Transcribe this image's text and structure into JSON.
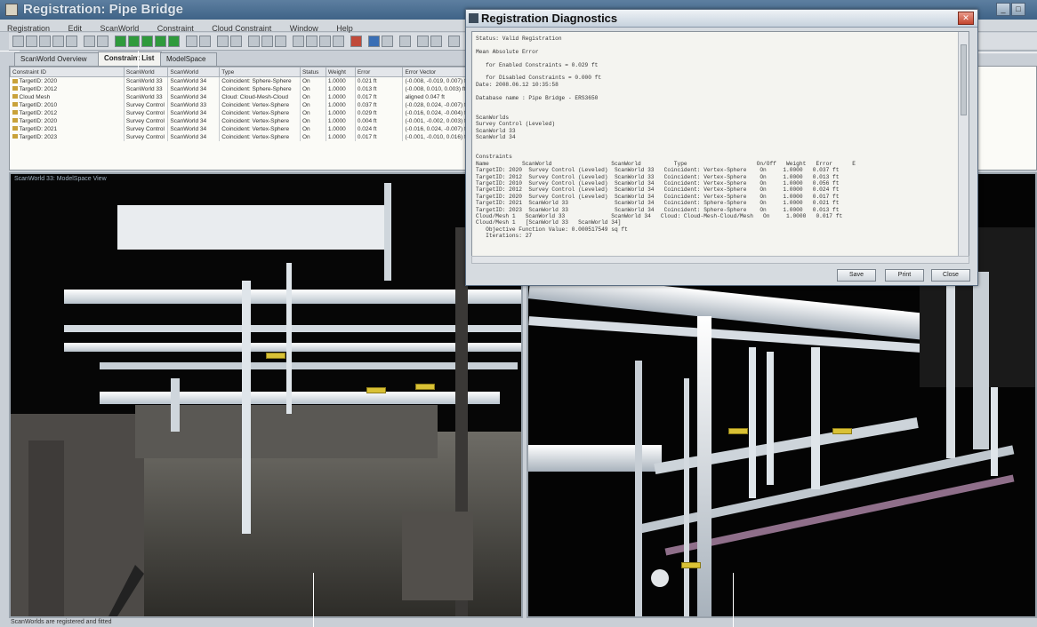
{
  "window": {
    "title": "Registration: Pipe Bridge"
  },
  "menu": [
    "Registration",
    "Edit",
    "ScanWorld",
    "Constraint",
    "Cloud Constraint",
    "Window",
    "Help"
  ],
  "tabs": [
    "ScanWorld Overview",
    "Constraint List",
    "ModelSpace"
  ],
  "constraint_table": {
    "columns": [
      "Constraint ID",
      "ScanWorld",
      "ScanWorld",
      "Type",
      "Status",
      "Weight",
      "Error",
      "Error Vector"
    ],
    "rows": [
      [
        "TargetID: 2020",
        "ScanWorld 33",
        "ScanWorld 34",
        "Coincident: Sphere-Sphere",
        "On",
        "1.0000",
        "0.021 ft",
        "(-0.008, -0.019, 0.007) ft"
      ],
      [
        "TargetID: 2012",
        "ScanWorld 33",
        "ScanWorld 34",
        "Coincident: Sphere-Sphere",
        "On",
        "1.0000",
        "0.013 ft",
        "(-0.008, 0.010, 0.003) ft"
      ],
      [
        "Cloud Mesh",
        "ScanWorld 33",
        "ScanWorld 34",
        "Cloud: Cloud-Mesh-Cloud",
        "On",
        "1.0000",
        "0.017 ft",
        "aligned 0.047 ft"
      ],
      [
        "TargetID: 2010",
        "Survey Control",
        "ScanWorld 33",
        "Coincident: Vertex-Sphere",
        "On",
        "1.0000",
        "0.037 ft",
        "(-0.028, 0.024, -0.007) ft"
      ],
      [
        "TargetID: 2012",
        "Survey Control",
        "ScanWorld 34",
        "Coincident: Vertex-Sphere",
        "On",
        "1.0000",
        "0.029 ft",
        "(-0.016, 0.024, -0.004) ft"
      ],
      [
        "TargetID: 2020",
        "Survey Control",
        "ScanWorld 34",
        "Coincident: Vertex-Sphere",
        "On",
        "1.0000",
        "0.004 ft",
        "(-0.001, -0.002, 0.003) ft"
      ],
      [
        "TargetID: 2021",
        "Survey Control",
        "ScanWorld 34",
        "Coincident: Vertex-Sphere",
        "On",
        "1.0000",
        "0.024 ft",
        "(-0.016, 0.024, -0.007) ft"
      ],
      [
        "TargetID: 2023",
        "Survey Control",
        "ScanWorld 34",
        "Coincident: Vertex-Sphere",
        "On",
        "1.0000",
        "0.017 ft",
        "(-0.001, -0.010, 0.016) ft"
      ]
    ]
  },
  "viewports": {
    "left_label": "ScanWorld 33: ModelSpace View",
    "right_label": ""
  },
  "status_bar": "ScanWorlds are registered and fitted",
  "dialog": {
    "title": "Registration Diagnostics",
    "text": "Status: Valid Registration\n\nMean Absolute Error\n\n   for Enabled Constraints = 0.029 ft\n\n   for Disabled Constraints = 0.000 ft\nDate: 2008.06.12 10:35:58\n\nDatabase name : Pipe Bridge - ERS3650\n\n\nScanWorlds\nSurvey Control (Leveled)\nScanWorld 33\nScanWorld 34\n\n\nConstraints\nName          ScanWorld                  ScanWorld          Type                     On/Off   Weight   Error      E\nTargetID: 2020  Survey Control (Leveled)  ScanWorld 33   Coincident: Vertex-Sphere    On     1.0000   0.037 ft\nTargetID: 2012  Survey Control (Leveled)  ScanWorld 33   Coincident: Vertex-Sphere    On     1.0000   0.013 ft\nTargetID: 2010  Survey Control (Leveled)  ScanWorld 34   Coincident: Vertex-Sphere    On     1.0000   0.056 ft\nTargetID: 2012  Survey Control (Leveled)  ScanWorld 34   Coincident: Vertex-Sphere    On     1.0000   0.024 ft\nTargetID: 2020  Survey Control (Leveled)  ScanWorld 34   Coincident: Vertex-Sphere    On     1.0000   0.017 ft\nTargetID: 2021  ScanWorld 33              ScanWorld 34   Coincident: Sphere-Sphere    On     1.0000   0.021 ft\nTargetID: 2023  ScanWorld 33              ScanWorld 34   Coincident: Sphere-Sphere    On     1.0000   0.013 ft\nCloud/Mesh 1   ScanWorld 33              ScanWorld 34   Cloud: Cloud-Mesh-Cloud/Mesh   On     1.0000   0.017 ft\nCloud/Mesh 1   [ScanWorld 33   ScanWorld 34]\n   Objective Function Value: 0.000517549 sq ft\n   Iterations: 27",
    "buttons": [
      "Save",
      "Print",
      "Close"
    ]
  }
}
